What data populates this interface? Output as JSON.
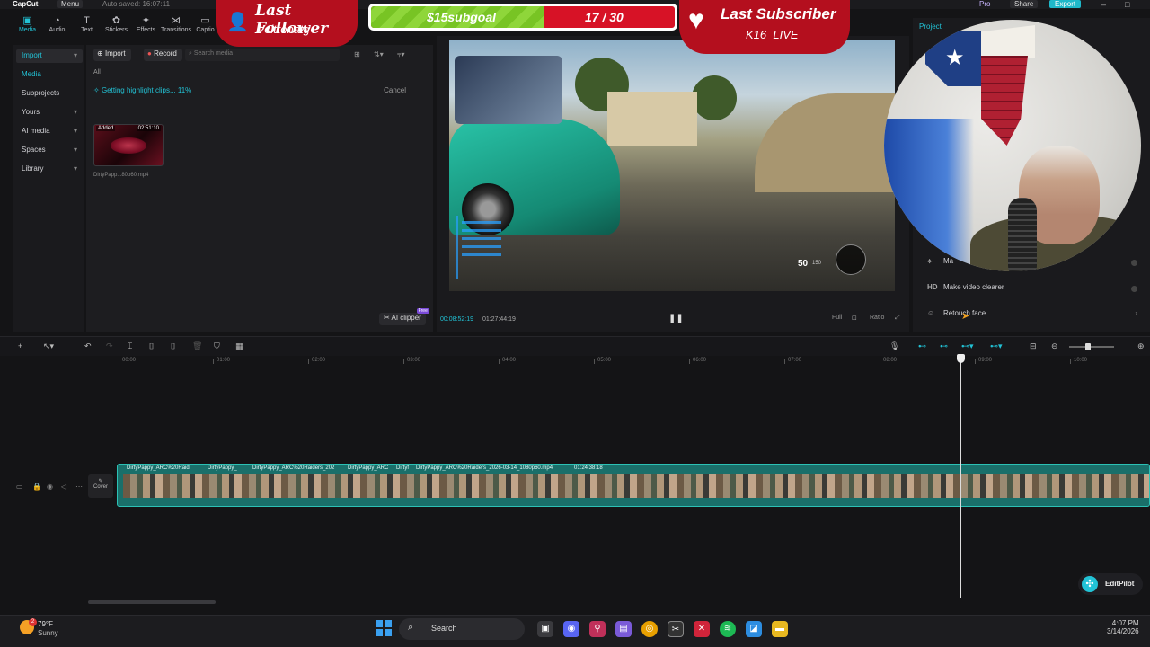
{
  "topbar": {
    "logo": "CapCut",
    "menu": "Menu",
    "autosave": "Auto saved: 16:07:11",
    "pro": "Pro",
    "share": "Share",
    "export": "Export"
  },
  "tools": [
    {
      "label": "Media",
      "icon": "media-icon"
    },
    {
      "label": "Audio",
      "icon": "audio-icon"
    },
    {
      "label": "Text",
      "icon": "text-icon"
    },
    {
      "label": "Stickers",
      "icon": "stickers-icon"
    },
    {
      "label": "Effects",
      "icon": "effects-icon"
    },
    {
      "label": "Transitions",
      "icon": "transitions-icon"
    },
    {
      "label": "Captio",
      "icon": "captions-icon"
    }
  ],
  "sidebar": {
    "items": [
      {
        "label": "Import"
      },
      {
        "label": "Media"
      },
      {
        "label": "Subprojects"
      },
      {
        "label": "Yours"
      },
      {
        "label": "AI media"
      },
      {
        "label": "Spaces"
      },
      {
        "label": "Library"
      }
    ]
  },
  "media": {
    "import_label": "Import",
    "record_label": "Record",
    "search_placeholder": "Search media",
    "all_label": "All",
    "highlight_text": "Getting highlight clips... 11%",
    "cancel_label": "Cancel",
    "thumb_added": "Added",
    "thumb_duration": "02:51:10",
    "thumb_name": "DirtyPapp...80p60.mp4",
    "ai_clipper": "AI clipper",
    "free_badge": "Free"
  },
  "player": {
    "current_time": "00:08:52:19",
    "total_time": "01:27:44:19",
    "ctrl_full": "Full",
    "ctrl_ratio": "Ratio",
    "hud_count": "50",
    "hud_total": "150"
  },
  "overlays": {
    "follower_title": "Last Follower",
    "follower_name": "Voltronatg",
    "goal_left": "$15subgoal",
    "goal_right": "17 / 30",
    "goal_progress": 0.57,
    "subscriber_title": "Last Subscriber",
    "subscriber_name": "K16_LIVE"
  },
  "rpanel": {
    "tab": "Project",
    "partial_row": "Ma",
    "make_video_clearer": "Make video clearer",
    "make_video_clearer_icon": "HD",
    "retouch_face": "Retouch face"
  },
  "timeline": {
    "ticks": [
      "00:00",
      "01:00",
      "02:00",
      "03:00",
      "04:00",
      "05:00",
      "06:00",
      "07:00",
      "08:00",
      "09:00",
      "10:00"
    ],
    "cover_label": "Cover",
    "clip_labels": [
      "DirtyPappy_ARC%20Raid",
      "DirtyPappy_",
      "DirtyPappy_ARC%20Raiders_202",
      "DirtyPappy_ARC",
      "Dirtyf",
      "DirtyPappy_ARC%20Raiders_2026-03-14_1080p60.mp4",
      "01:24:38:18"
    ],
    "editpilot": "EditPilot"
  },
  "taskbar": {
    "temp": "79°F",
    "condition": "Sunny",
    "weather_badge": "2",
    "search": "Search",
    "time": "4:07 PM",
    "date": "3/14/2026"
  },
  "colors": {
    "accent": "#22c3d6",
    "overlay_red": "#b40f1e",
    "goal_green": "#8fd63a"
  }
}
